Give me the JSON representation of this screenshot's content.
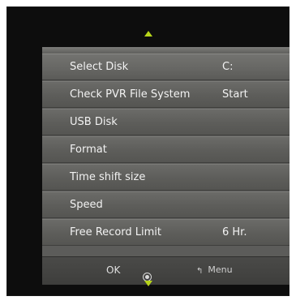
{
  "menu": {
    "items": [
      {
        "label": "Select Disk",
        "value": "C:"
      },
      {
        "label": "Check PVR File System",
        "value": "Start"
      },
      {
        "label": "USB Disk",
        "value": ""
      },
      {
        "label": "Format",
        "value": ""
      },
      {
        "label": "Time shift size",
        "value": ""
      },
      {
        "label": "Speed",
        "value": ""
      },
      {
        "label": "Free Record Limit",
        "value": "6 Hr."
      }
    ]
  },
  "footer": {
    "ok_label": "OK",
    "menu_label": "Menu"
  },
  "icons": {
    "up": "arrow-up-icon",
    "down": "arrow-down-icon",
    "ok": "ok-icon",
    "back": "back-icon"
  },
  "colors": {
    "accent_arrow": "#b7d51a",
    "panel": "#5c5c5a",
    "frame": "#0d0d0d"
  }
}
